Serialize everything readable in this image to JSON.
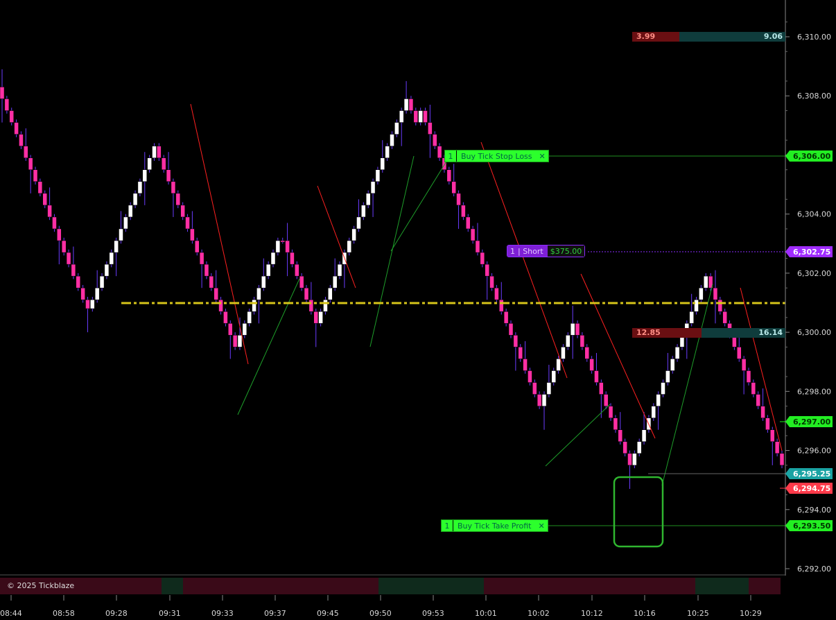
{
  "app": {
    "copyright": "© 2025 Tickblaze"
  },
  "colors": {
    "bull": "#ffffff",
    "bear": "#ff2fa4",
    "wick": "#6b3cff",
    "dash_line": "#d6c51a",
    "up_line": "#1e9e2a",
    "down_line": "#ff2020",
    "green_tag": "#22ee22",
    "purple_tag": "#a02cff",
    "teal_tag": "#1aa3a3",
    "red_tag": "#ff3a4a"
  },
  "price_axis": {
    "ticks": [
      "6,310.00",
      "6,308.00",
      "6,306.00",
      "6,304.00",
      "6,302.00",
      "6,300.00",
      "6,298.00",
      "6,296.00",
      "6,294.00",
      "6,292.00"
    ],
    "tick_values": [
      6310,
      6308,
      6306,
      6304,
      6302,
      6300,
      6298,
      6296,
      6294,
      6292
    ]
  },
  "time_axis": {
    "labels": [
      "08:44",
      "08:58",
      "09:28",
      "09:31",
      "09:33",
      "09:37",
      "09:45",
      "09:50",
      "09:53",
      "10:01",
      "10:02",
      "10:12",
      "10:16",
      "10:25",
      "10:29"
    ]
  },
  "price_tags": {
    "stop_loss": "6,306.00",
    "position": "6,302.75",
    "green": "6,297.00",
    "last": "6,295.25",
    "bid": "6,294.75",
    "take_profit": "6,293.50"
  },
  "orders": {
    "stop": {
      "qty": "1",
      "label": "Buy Tick Stop Loss",
      "close": "✕"
    },
    "take": {
      "qty": "1",
      "label": "Buy Tick Take Profit",
      "close": "✕"
    },
    "position": {
      "qty": "1",
      "side": "| Short",
      "pnl": "$375.00"
    }
  },
  "boxes": {
    "top": {
      "left": "3.99",
      "right": "9.06"
    },
    "mid": {
      "left": "12.85",
      "right": "16.14"
    }
  },
  "chart_data": {
    "type": "candlestick",
    "y_range": [
      6291.8,
      6311.0
    ],
    "key_level": 6301.0,
    "hist_line": 6295.25
  }
}
